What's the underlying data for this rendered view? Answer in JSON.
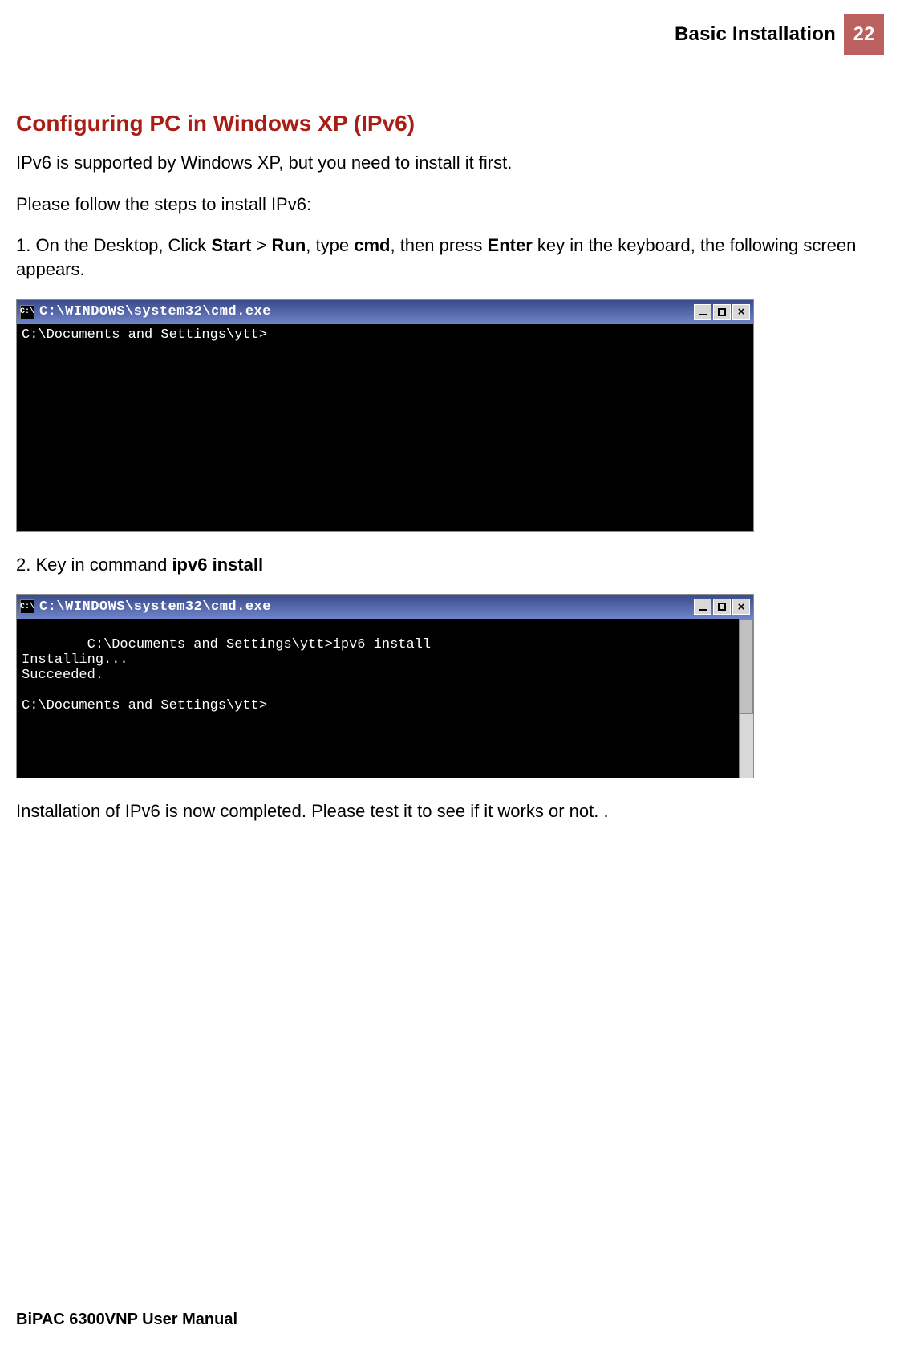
{
  "header": {
    "chapter": "Basic Installation",
    "page_number": "22"
  },
  "section": {
    "heading": "Configuring PC in Windows XP (IPv6)"
  },
  "para": {
    "p1": "IPv6 is supported by Windows XP, but you need to install it first.",
    "p2": "Please follow the steps to install IPv6:",
    "step1_prefix": "1. On the Desktop, Click ",
    "step1_start": "Start",
    "step1_gt": " > ",
    "step1_run": "Run",
    "step1_mid": ", type ",
    "step1_cmd": "cmd",
    "step1_mid2": ", then press ",
    "step1_enter": "Enter",
    "step1_suffix": " key in the keyboard, the following screen appears.",
    "step2_prefix": "2. Key in command ",
    "step2_cmd": "ipv6 install",
    "closing": "Installation of IPv6 is now completed.  Please test it to see if it works or not. ."
  },
  "terminal1": {
    "title": "C:\\WINDOWS\\system32\\cmd.exe",
    "icon_text": "C:\\",
    "body": "C:\\Documents and Settings\\ytt>"
  },
  "terminal2": {
    "title": "C:\\WINDOWS\\system32\\cmd.exe",
    "icon_text": "C:\\",
    "body": "C:\\Documents and Settings\\ytt>ipv6 install\nInstalling...\nSucceeded.\n\nC:\\Documents and Settings\\ytt>"
  },
  "footer": {
    "manual": "BiPAC 6300VNP User Manual"
  },
  "icons": {
    "minimize": "minimize-icon",
    "maximize": "maximize-icon",
    "close": "close-icon",
    "sysmenu": "cmd-sysmenu-icon"
  }
}
